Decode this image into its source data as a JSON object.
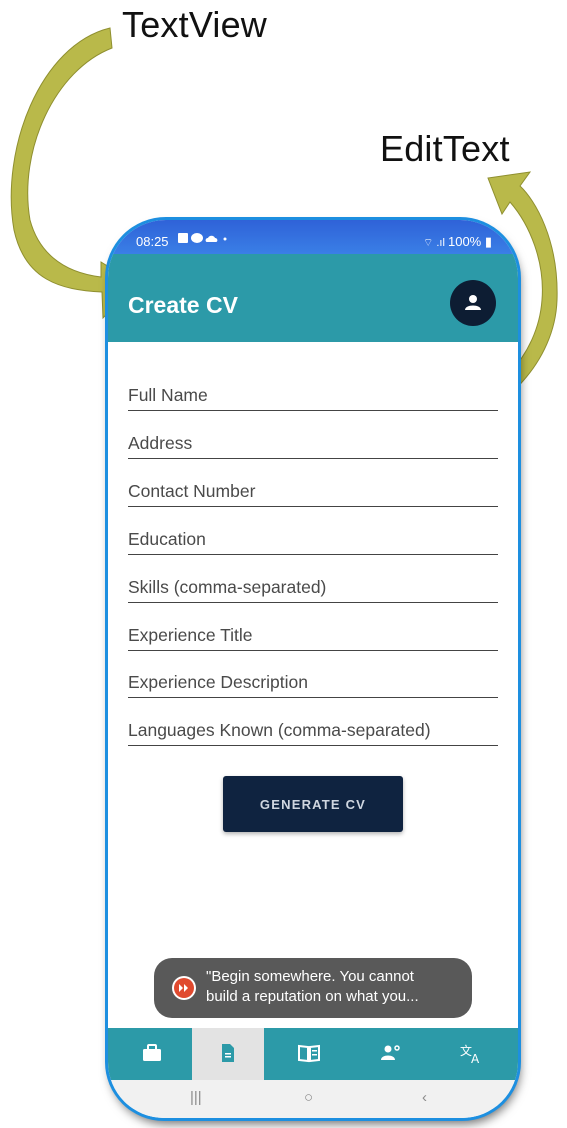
{
  "annotations": {
    "textview_label": "TextView",
    "edittext_label": "EditText",
    "arrow_color": "#b9b94a"
  },
  "status_bar": {
    "time": "08:25",
    "battery": "100%",
    "left_icons": "image-icon, chat-icon, cloud-icon, dot",
    "right_icons": "wifi-icon, signal-icon, battery-icon"
  },
  "app_bar": {
    "title": "Create CV",
    "avatar_icon": "person-icon",
    "color": "#2c9aa8"
  },
  "form": {
    "fields": [
      {
        "placeholder": "Full Name"
      },
      {
        "placeholder": "Address"
      },
      {
        "placeholder": "Contact Number"
      },
      {
        "placeholder": "Education"
      },
      {
        "placeholder": "Skills (comma-separated)"
      },
      {
        "placeholder": "Experience Title"
      },
      {
        "placeholder": "Experience Description"
      },
      {
        "placeholder": "Languages Known (comma-separated)"
      }
    ],
    "generate_label": "GENERATE CV",
    "button_color": "#0f2340"
  },
  "toast": {
    "line1": "\"Begin somewhere. You cannot",
    "line2": "build a reputation on what you...",
    "icon": "fast-forward-icon"
  },
  "bottom_nav": {
    "items": [
      "briefcase-icon",
      "document-icon",
      "book-icon",
      "people-icon",
      "translate-icon"
    ],
    "active_index": 1
  },
  "system_nav": {
    "recents": "|||",
    "home": "○",
    "back": "‹"
  }
}
